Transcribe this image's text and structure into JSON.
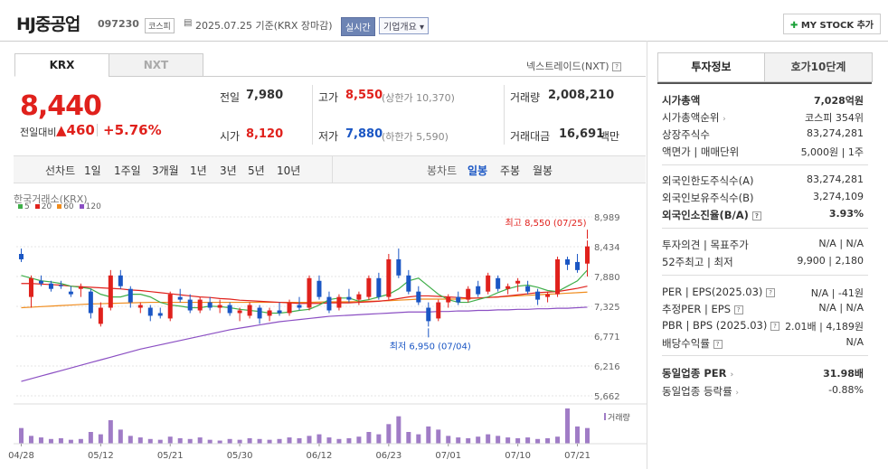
{
  "header": {
    "company": "HJ중공업",
    "code": "097230",
    "market": "코스피",
    "date_text": "2025.07.25  기준(KRX 장마감)",
    "realtime_label": "실시간",
    "overview_label": "기업개요 ▾",
    "mystock_label": "MY STOCK 추가"
  },
  "exchange_tabs": [
    "KRX",
    "NXT"
  ],
  "nxt_note": "넥스트레이드(NXT)",
  "quote": {
    "price": "8,440",
    "change_label": "전일대비",
    "change_arrow": "▲",
    "change": "460",
    "change_pct": "+5.76%",
    "prev_label": "전일",
    "prev": "7,980",
    "high_label": "고가",
    "high": "8,550",
    "upper_limit": "(상한가 10,370)",
    "volume_label": "거래량",
    "volume": "2,008,210",
    "open_label": "시가",
    "open": "8,120",
    "low_label": "저가",
    "low": "7,880",
    "lower_limit": "(하한가 5,590)",
    "amount_label": "거래대금",
    "amount": "16,691",
    "amount_unit": "백만"
  },
  "period_bar": {
    "line_label": "선차트",
    "periods": [
      "1일",
      "1주일",
      "3개월",
      "1년",
      "3년",
      "5년",
      "10년"
    ],
    "candle_label": "봉차트",
    "candle_periods": [
      "일봉",
      "주봉",
      "월봉"
    ],
    "active_candle": "일봉"
  },
  "chart_data": {
    "type": "candlestick",
    "source_label": "한국거래소(KRX)",
    "ma_legend": [
      {
        "name": "5",
        "color": "#3fae49"
      },
      {
        "name": "20",
        "color": "#e0211c"
      },
      {
        "name": "60",
        "color": "#f08c1d"
      },
      {
        "name": "120",
        "color": "#8b4fc3"
      }
    ],
    "y_ticks": [
      "8,989",
      "8,434",
      "7,880",
      "7,325",
      "6,771",
      "6,216",
      "5,662"
    ],
    "ylim": [
      5662,
      8989
    ],
    "x_ticks": [
      "04/28",
      "05/12",
      "05/21",
      "05/30",
      "06/12",
      "06/23",
      "07/01",
      "07/10",
      "07/21"
    ],
    "high_annotation": "최고 8,550 (07/25)",
    "low_annotation": "최저 6,950 (07/04)",
    "volume_label": "거래량",
    "candles": [
      {
        "o": 8300,
        "h": 8400,
        "l": 8150,
        "c": 8200
      },
      {
        "o": 7500,
        "h": 7900,
        "l": 7300,
        "c": 7850
      },
      {
        "o": 7800,
        "h": 7900,
        "l": 7700,
        "c": 7750
      },
      {
        "o": 7750,
        "h": 7800,
        "l": 7600,
        "c": 7650
      },
      {
        "o": 7720,
        "h": 7800,
        "l": 7650,
        "c": 7700
      },
      {
        "o": 7600,
        "h": 7700,
        "l": 7500,
        "c": 7550
      },
      {
        "o": 7650,
        "h": 7750,
        "l": 7500,
        "c": 7700
      },
      {
        "o": 7600,
        "h": 7650,
        "l": 7100,
        "c": 7200
      },
      {
        "o": 7000,
        "h": 7400,
        "l": 6950,
        "c": 7300
      },
      {
        "o": 7300,
        "h": 8000,
        "l": 7250,
        "c": 7900
      },
      {
        "o": 7900,
        "h": 8000,
        "l": 7650,
        "c": 7700
      },
      {
        "o": 7650,
        "h": 7700,
        "l": 7300,
        "c": 7400
      },
      {
        "o": 7300,
        "h": 7400,
        "l": 7200,
        "c": 7350
      },
      {
        "o": 7300,
        "h": 7350,
        "l": 7050,
        "c": 7150
      },
      {
        "o": 7200,
        "h": 7300,
        "l": 7100,
        "c": 7150
      },
      {
        "o": 7100,
        "h": 7600,
        "l": 7050,
        "c": 7550
      },
      {
        "o": 7500,
        "h": 7650,
        "l": 7400,
        "c": 7450
      },
      {
        "o": 7450,
        "h": 7550,
        "l": 7200,
        "c": 7250
      },
      {
        "o": 7250,
        "h": 7500,
        "l": 7200,
        "c": 7450
      },
      {
        "o": 7400,
        "h": 7500,
        "l": 7250,
        "c": 7300
      },
      {
        "o": 7300,
        "h": 7450,
        "l": 7200,
        "c": 7350
      },
      {
        "o": 7350,
        "h": 7400,
        "l": 7150,
        "c": 7200
      },
      {
        "o": 7200,
        "h": 7300,
        "l": 7050,
        "c": 7250
      },
      {
        "o": 7150,
        "h": 7400,
        "l": 7100,
        "c": 7350
      },
      {
        "o": 7300,
        "h": 7350,
        "l": 7000,
        "c": 7100
      },
      {
        "o": 7150,
        "h": 7300,
        "l": 7050,
        "c": 7250
      },
      {
        "o": 7250,
        "h": 7400,
        "l": 7150,
        "c": 7200
      },
      {
        "o": 7200,
        "h": 7450,
        "l": 7150,
        "c": 7400
      },
      {
        "o": 7350,
        "h": 7500,
        "l": 7250,
        "c": 7300
      },
      {
        "o": 7300,
        "h": 7900,
        "l": 7250,
        "c": 7850
      },
      {
        "o": 7800,
        "h": 7900,
        "l": 7450,
        "c": 7500
      },
      {
        "o": 7500,
        "h": 7600,
        "l": 7200,
        "c": 7250
      },
      {
        "o": 7300,
        "h": 7550,
        "l": 7250,
        "c": 7500
      },
      {
        "o": 7500,
        "h": 7650,
        "l": 7400,
        "c": 7450
      },
      {
        "o": 7450,
        "h": 7600,
        "l": 7350,
        "c": 7550
      },
      {
        "o": 7500,
        "h": 7900,
        "l": 7450,
        "c": 7850
      },
      {
        "o": 7850,
        "h": 7950,
        "l": 7450,
        "c": 7500
      },
      {
        "o": 7500,
        "h": 8300,
        "l": 7450,
        "c": 8200
      },
      {
        "o": 8200,
        "h": 8400,
        "l": 7850,
        "c": 7900
      },
      {
        "o": 7900,
        "h": 8000,
        "l": 7550,
        "c": 7600
      },
      {
        "o": 7600,
        "h": 7700,
        "l": 7350,
        "c": 7400
      },
      {
        "o": 7300,
        "h": 7400,
        "l": 6950,
        "c": 7050
      },
      {
        "o": 7100,
        "h": 7450,
        "l": 7050,
        "c": 7400
      },
      {
        "o": 7400,
        "h": 7550,
        "l": 7300,
        "c": 7500
      },
      {
        "o": 7500,
        "h": 7600,
        "l": 7350,
        "c": 7400
      },
      {
        "o": 7450,
        "h": 7700,
        "l": 7400,
        "c": 7650
      },
      {
        "o": 7700,
        "h": 7800,
        "l": 7500,
        "c": 7550
      },
      {
        "o": 7600,
        "h": 7950,
        "l": 7550,
        "c": 7900
      },
      {
        "o": 7850,
        "h": 7900,
        "l": 7600,
        "c": 7650
      },
      {
        "o": 7650,
        "h": 7750,
        "l": 7550,
        "c": 7700
      },
      {
        "o": 7750,
        "h": 7850,
        "l": 7600,
        "c": 7800
      },
      {
        "o": 7700,
        "h": 7800,
        "l": 7550,
        "c": 7600
      },
      {
        "o": 7600,
        "h": 7650,
        "l": 7350,
        "c": 7450
      },
      {
        "o": 7500,
        "h": 7600,
        "l": 7400,
        "c": 7550
      },
      {
        "o": 7550,
        "h": 8250,
        "l": 7500,
        "c": 8200
      },
      {
        "o": 8200,
        "h": 8250,
        "l": 8000,
        "c": 8100
      },
      {
        "o": 8150,
        "h": 8300,
        "l": 7950,
        "c": 8000
      },
      {
        "o": 8120,
        "h": 8550,
        "l": 7880,
        "c": 8440
      }
    ],
    "ma5": [
      7900,
      7850,
      7800,
      7780,
      7750,
      7700,
      7680,
      7650,
      7550,
      7500,
      7500,
      7550,
      7550,
      7500,
      7400,
      7350,
      7330,
      7300,
      7300,
      7330,
      7320,
      7300,
      7270,
      7250,
      7230,
      7200,
      7200,
      7220,
      7250,
      7270,
      7350,
      7450,
      7480,
      7480,
      7420,
      7450,
      7500,
      7550,
      7650,
      7800,
      7850,
      7700,
      7550,
      7450,
      7400,
      7400,
      7450,
      7500,
      7580,
      7650,
      7700,
      7720,
      7680,
      7620,
      7600,
      7700,
      7800,
      8000
    ],
    "ma20": [
      7750,
      7750,
      7740,
      7730,
      7720,
      7700,
      7690,
      7680,
      7670,
      7660,
      7650,
      7630,
      7620,
      7600,
      7580,
      7560,
      7540,
      7520,
      7500,
      7490,
      7470,
      7460,
      7440,
      7430,
      7420,
      7410,
      7400,
      7390,
      7380,
      7380,
      7380,
      7390,
      7390,
      7390,
      7400,
      7410,
      7420,
      7440,
      7470,
      7500,
      7520,
      7520,
      7510,
      7500,
      7490,
      7480,
      7480,
      7490,
      7500,
      7520,
      7540,
      7560,
      7580,
      7590,
      7600,
      7630,
      7660,
      7700
    ],
    "ma60": [
      7300,
      7310,
      7320,
      7330,
      7340,
      7350,
      7360,
      7370,
      7375,
      7380,
      7385,
      7390,
      7395,
      7400,
      7400,
      7400,
      7400,
      7400,
      7400,
      7400,
      7400,
      7400,
      7400,
      7400,
      7400,
      7400,
      7400,
      7400,
      7400,
      7400,
      7405,
      7410,
      7410,
      7410,
      7415,
      7420,
      7425,
      7430,
      7440,
      7450,
      7460,
      7460,
      7460,
      7460,
      7460,
      7470,
      7480,
      7490,
      7500,
      7510,
      7520,
      7530,
      7540,
      7550,
      7560,
      7570,
      7580,
      7590
    ],
    "ma120": [
      5930,
      5980,
      6030,
      6080,
      6130,
      6180,
      6230,
      6280,
      6330,
      6380,
      6430,
      6480,
      6530,
      6570,
      6610,
      6650,
      6690,
      6730,
      6770,
      6810,
      6850,
      6890,
      6920,
      6950,
      6980,
      7010,
      7040,
      7060,
      7080,
      7100,
      7120,
      7140,
      7150,
      7160,
      7170,
      7180,
      7190,
      7200,
      7210,
      7220,
      7220,
      7220,
      7230,
      7230,
      7240,
      7240,
      7250,
      7250,
      7260,
      7260,
      7270,
      7270,
      7280,
      7280,
      7290,
      7290,
      7300,
      7310
    ],
    "volumes": [
      20,
      10,
      8,
      6,
      7,
      5,
      6,
      15,
      12,
      30,
      18,
      10,
      8,
      6,
      5,
      9,
      7,
      6,
      8,
      5,
      4,
      6,
      5,
      7,
      6,
      5,
      6,
      8,
      7,
      10,
      12,
      8,
      6,
      7,
      9,
      15,
      12,
      25,
      35,
      15,
      12,
      22,
      18,
      10,
      8,
      7,
      9,
      12,
      10,
      8,
      7,
      8,
      6,
      7,
      9,
      45,
      22,
      20
    ]
  },
  "right": {
    "tabs": [
      "투자정보",
      "호가10단계"
    ],
    "rows": [
      {
        "k": "시가총액",
        "v": "7,028억원"
      },
      {
        "k": "시가총액순위",
        "v": "코스피 354위"
      },
      {
        "k": "상장주식수",
        "v": "83,274,281"
      },
      {
        "k": "액면가 | 매매단위",
        "v": "5,000원 | 1주"
      },
      {
        "k": "외국인한도주식수(A)",
        "v": "83,274,281"
      },
      {
        "k": "외국인보유주식수(B)",
        "v": "3,274,109"
      },
      {
        "k": "외국인소진율(B/A)",
        "v": "3.93%"
      },
      {
        "k": "투자의견 | 목표주가",
        "v": "N/A | N/A"
      },
      {
        "k": "52주최고 | 최저",
        "v": "9,900 | 2,180"
      },
      {
        "k": "PER | EPS(2025.03)",
        "v": "N/A | -41원"
      },
      {
        "k": "추정PER | EPS",
        "v": "N/A | N/A"
      },
      {
        "k": "PBR | BPS (2025.03)",
        "v": "2.01배 | 4,189원"
      },
      {
        "k": "배당수익률",
        "v": "N/A"
      },
      {
        "k": "동일업종 PER",
        "v": "31.98배"
      },
      {
        "k": "동일업종 등락률",
        "v": "-0.88%"
      }
    ]
  }
}
